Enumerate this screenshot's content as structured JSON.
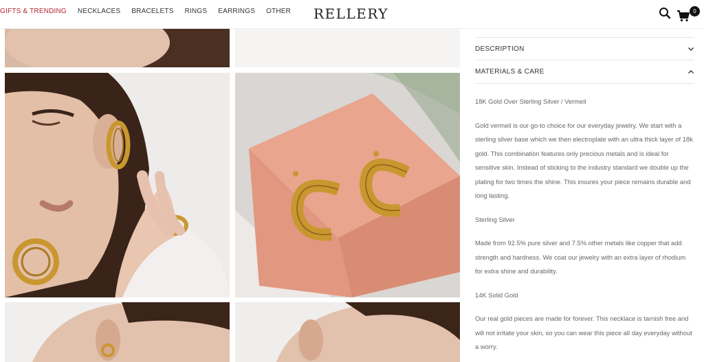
{
  "header": {
    "logo": "RELLERY",
    "nav": [
      "GIFTS & TRENDING",
      "NECKLACES",
      "BRACELETS",
      "RINGS",
      "EARRINGS",
      "OTHER"
    ],
    "cart_count": "0"
  },
  "accordion": {
    "description_label": "DESCRIPTION",
    "materials_label": "MATERIALS & CARE"
  },
  "materials": {
    "vermeil_title": "18K Gold Over Sterling Silver / Vermeil",
    "vermeil_text": "Gold vermeil is our go-to choice for our everyday jewelry. We start with a sterling silver base which we then electroplate with an ultra thick layer of 18k gold. This combination features only precious metals and is ideal for sensitive skin. Instead of sticking to the industry standard we double up the plating for two times the shine. This insures your piece remains durable and long lasting.",
    "silver_title": "Sterling Silver",
    "silver_text": "Made from 92.5% pure silver and 7.5% other metals like copper that add strength and hardness. We coat our jewelry with an extra layer of rhodium for extra shine and durability.",
    "gold_title": "14K Solid Gold",
    "gold_text": "Our real gold pieces are made for forever. This necklace is tarnish free and will not irritate your skin, so you can wear this piece all day everyday without a worry."
  },
  "colors": {
    "accent": "#b3262e",
    "gold": "#c9972f",
    "box": "#e8a08a"
  },
  "icons": [
    "search-icon",
    "cart-icon",
    "chevron-down-icon",
    "chevron-up-icon"
  ]
}
